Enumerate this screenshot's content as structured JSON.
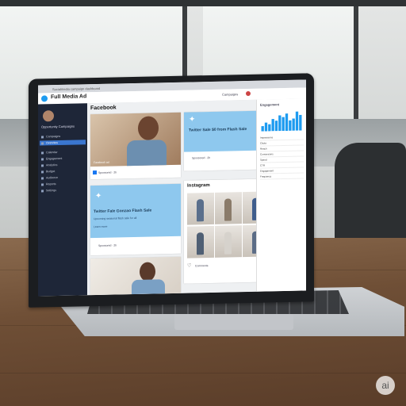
{
  "app": {
    "title": "Full Media Ad"
  },
  "browser": {
    "tab_text": "Socialmedia campaign dashboard"
  },
  "sidebar": {
    "user_name": "Opportunity Campaigns",
    "items": [
      {
        "label": "Campaigns",
        "active": false
      },
      {
        "label": "Overview",
        "active": true
      },
      {
        "label": "Calendar",
        "active": false
      },
      {
        "label": "Engagement",
        "active": false
      },
      {
        "label": "Analytics",
        "active": false
      },
      {
        "label": "Budget",
        "active": false
      },
      {
        "label": "Audience",
        "active": false
      },
      {
        "label": "Reports",
        "active": false
      },
      {
        "label": "Settings",
        "active": false
      }
    ]
  },
  "header": {
    "right_label": "Campaigns"
  },
  "facebook": {
    "section_title": "Facebook",
    "photo_caption": "Facebook ad",
    "meta": "Sponsored · 2h"
  },
  "twitter_top": {
    "headline": "Twitter Sale $0 from Flash Sale",
    "meta": "Sponsored · 2h"
  },
  "twitter_bottom": {
    "headline": "Twitter Fale Gonzao Flash Sale",
    "subline": "Upcoming seasonal flash sale for all",
    "link": "Learn more",
    "meta": "Sponsored · 2h"
  },
  "instagram": {
    "section_title": "Instagram",
    "footer": "Comments"
  },
  "right_panel": {
    "title": "Engagement",
    "rows": [
      "Impressions",
      "Clicks",
      "Reach",
      "Conversions",
      "Spend",
      "CTR",
      "Engagement",
      "Frequency"
    ]
  },
  "chart_data": {
    "type": "bar",
    "values": [
      3,
      5,
      4,
      7,
      6,
      9,
      8,
      10,
      6,
      7,
      11,
      9
    ]
  },
  "colors": {
    "accent": "#1d9bf0",
    "sidebar": "#1e2638",
    "twitter_card": "#8ec8ee"
  },
  "badge": {
    "text": "ai"
  }
}
